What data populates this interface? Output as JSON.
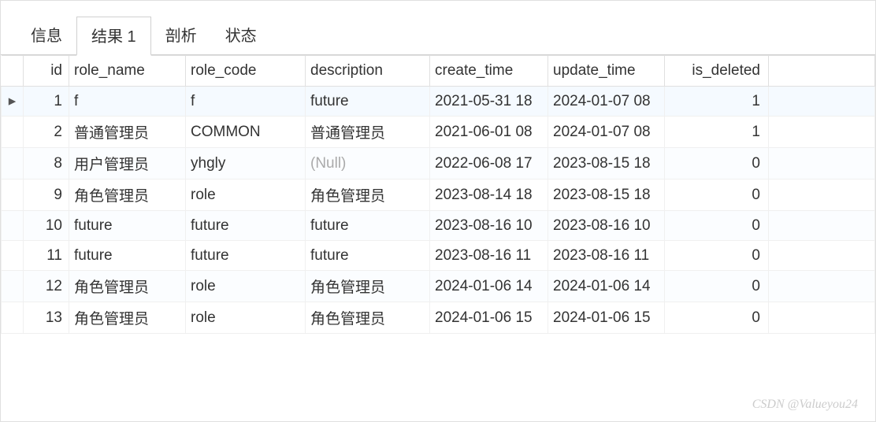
{
  "tabs": [
    {
      "label": "信息",
      "active": false
    },
    {
      "label": "结果 1",
      "active": true
    },
    {
      "label": "剖析",
      "active": false
    },
    {
      "label": "状态",
      "active": false
    }
  ],
  "columns": {
    "id": "id",
    "role_name": "role_name",
    "role_code": "role_code",
    "description": "description",
    "create_time": "create_time",
    "update_time": "update_time",
    "is_deleted": "is_deleted"
  },
  "null_label": "(Null)",
  "marker": "▸",
  "rows": [
    {
      "selected": true,
      "id": "1",
      "role_name": "f",
      "role_code": "f",
      "description": "future",
      "create_time": "2021-05-31 18",
      "update_time": "2024-01-07 08",
      "is_deleted": "1"
    },
    {
      "selected": false,
      "id": "2",
      "role_name": "普通管理员",
      "role_code": "COMMON",
      "description": "普通管理员",
      "create_time": "2021-06-01 08",
      "update_time": "2024-01-07 08",
      "is_deleted": "1"
    },
    {
      "selected": false,
      "id": "8",
      "role_name": "用户管理员",
      "role_code": "yhgly",
      "description": null,
      "create_time": "2022-06-08 17",
      "update_time": "2023-08-15 18",
      "is_deleted": "0"
    },
    {
      "selected": false,
      "id": "9",
      "role_name": "角色管理员",
      "role_code": "role",
      "description": "角色管理员",
      "create_time": "2023-08-14 18",
      "update_time": "2023-08-15 18",
      "is_deleted": "0"
    },
    {
      "selected": false,
      "id": "10",
      "role_name": "future",
      "role_code": "future",
      "description": "future",
      "create_time": "2023-08-16 10",
      "update_time": "2023-08-16 10",
      "is_deleted": "0"
    },
    {
      "selected": false,
      "id": "11",
      "role_name": "future",
      "role_code": "future",
      "description": "future",
      "create_time": "2023-08-16 11",
      "update_time": "2023-08-16 11",
      "is_deleted": "0"
    },
    {
      "selected": false,
      "id": "12",
      "role_name": "角色管理员",
      "role_code": "role",
      "description": "角色管理员",
      "create_time": "2024-01-06 14",
      "update_time": "2024-01-06 14",
      "is_deleted": "0"
    },
    {
      "selected": false,
      "id": "13",
      "role_name": "角色管理员",
      "role_code": "role",
      "description": "角色管理员",
      "create_time": "2024-01-06 15",
      "update_time": "2024-01-06 15",
      "is_deleted": "0"
    }
  ],
  "watermark": "CSDN @Valueyou24"
}
